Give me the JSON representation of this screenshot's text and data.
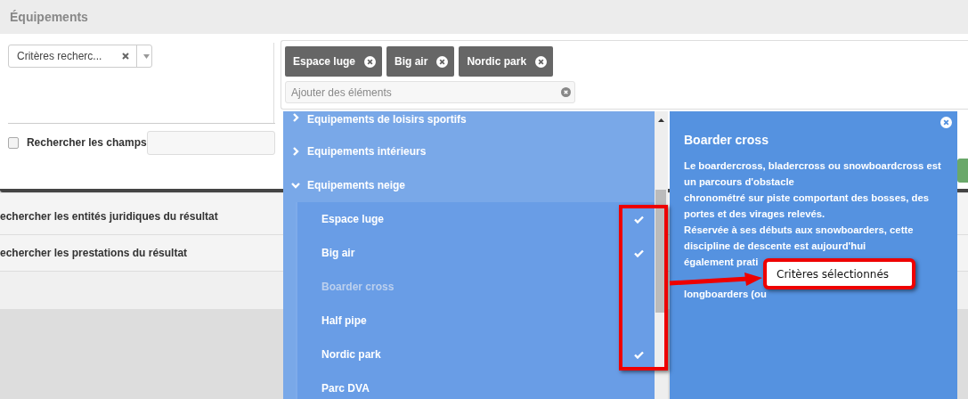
{
  "header": {
    "title": "Équipements"
  },
  "criteria_select": {
    "value": "Critères recherc..."
  },
  "tags": [
    {
      "label": "Espace luge"
    },
    {
      "label": "Big air"
    },
    {
      "label": "Nordic park"
    }
  ],
  "add_field": {
    "placeholder": "Ajouter des éléments"
  },
  "search_fields": {
    "label": "Rechercher les champs",
    "checked": false
  },
  "result_rows": [
    {
      "label": "echercher les entités juridiques du résultat"
    },
    {
      "label": "echercher les prestations du résultat"
    }
  ],
  "dropdown": {
    "groups": [
      {
        "label": "Equipements de loisirs sportifs",
        "expanded": false
      },
      {
        "label": "Equipements intérieurs",
        "expanded": false
      },
      {
        "label": "Equipements neige",
        "expanded": true,
        "children": [
          {
            "label": "Espace luge",
            "checked": true,
            "disabled": false
          },
          {
            "label": "Big air",
            "checked": true,
            "disabled": false
          },
          {
            "label": "Boarder cross",
            "checked": false,
            "disabled": true
          },
          {
            "label": "Half pipe",
            "checked": false,
            "disabled": false
          },
          {
            "label": "Nordic park",
            "checked": true,
            "disabled": false
          },
          {
            "label": "Parc DVA",
            "checked": false,
            "disabled": false
          }
        ]
      }
    ]
  },
  "detail": {
    "title": "Boarder cross",
    "lines": [
      "Le boardercross, bladercross ou snowboardcross est un parcours d'obstacle",
      "chronométré sur piste comportant des bosses, des portes et des virages relevés.",
      "Réservée à ses débuts aux snowboarders, cette discipline de descente est aujourd'hui",
      "également prati",
      "longboarders (ou"
    ]
  },
  "annotation": {
    "label": "Critères sélectionnés"
  }
}
